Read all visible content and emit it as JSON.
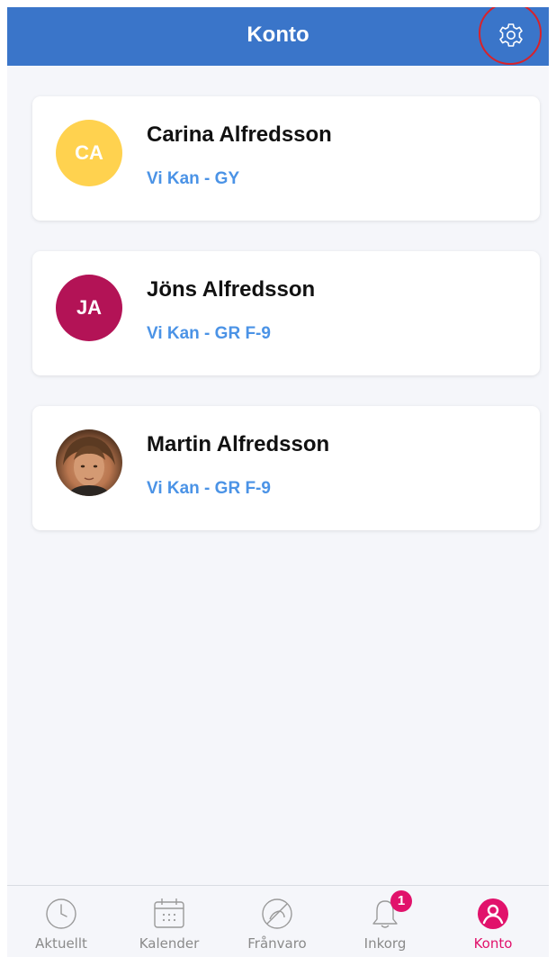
{
  "header": {
    "title": "Konto",
    "settings_icon": "gear-icon"
  },
  "accounts": [
    {
      "initials": "CA",
      "name": "Carina Alfredsson",
      "school": "Vi Kan - GY",
      "avatar_color": "#ffd24f",
      "avatar_type": "initials"
    },
    {
      "initials": "JA",
      "name": "Jöns Alfredsson",
      "school": "Vi Kan - GR F-9",
      "avatar_color": "#b31356",
      "avatar_type": "initials"
    },
    {
      "initials": "",
      "name": "Martin Alfredsson",
      "school": "Vi Kan - GR F-9",
      "avatar_type": "photo"
    }
  ],
  "tabbar": {
    "tabs": [
      {
        "label": "Aktuellt",
        "icon": "clock-icon",
        "active": false
      },
      {
        "label": "Kalender",
        "icon": "calendar-icon",
        "active": false
      },
      {
        "label": "Frånvaro",
        "icon": "absence-icon",
        "active": false
      },
      {
        "label": "Inkorg",
        "icon": "bell-icon",
        "active": false,
        "badge": "1"
      },
      {
        "label": "Konto",
        "icon": "account-icon",
        "active": true
      }
    ]
  },
  "colors": {
    "header": "#3a75c9",
    "accent": "#e1126b",
    "link": "#4b93e6",
    "background": "#f5f6fa",
    "highlight_ring": "#d8222a"
  }
}
